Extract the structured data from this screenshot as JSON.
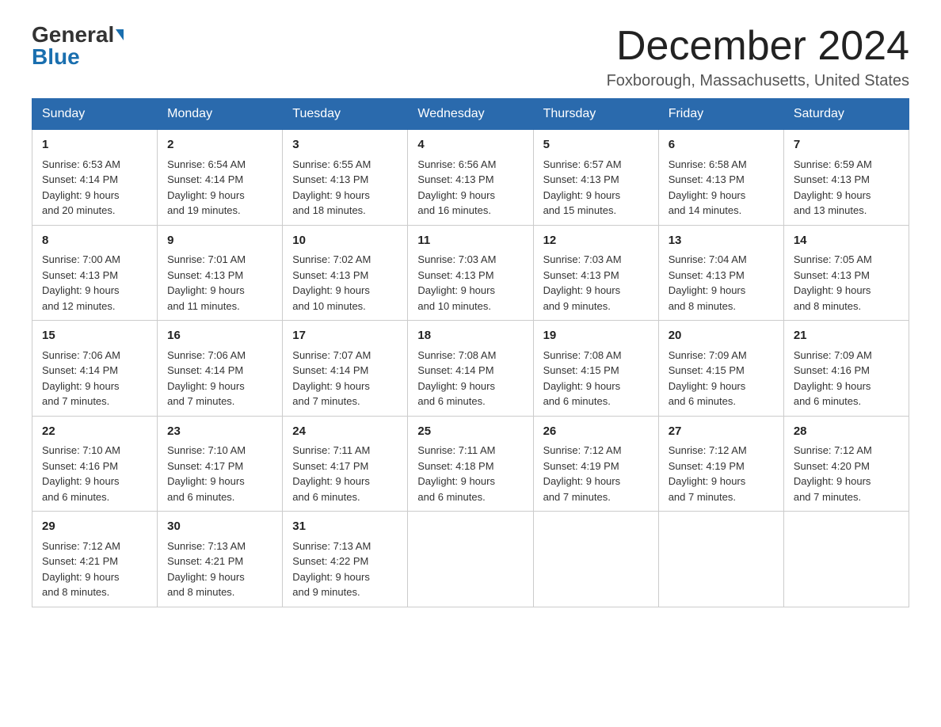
{
  "header": {
    "logo_general": "General",
    "logo_blue": "Blue",
    "month_title": "December 2024",
    "location": "Foxborough, Massachusetts, United States"
  },
  "weekdays": [
    "Sunday",
    "Monday",
    "Tuesday",
    "Wednesday",
    "Thursday",
    "Friday",
    "Saturday"
  ],
  "weeks": [
    [
      {
        "day": "1",
        "sunrise": "6:53 AM",
        "sunset": "4:14 PM",
        "daylight": "9 hours and 20 minutes."
      },
      {
        "day": "2",
        "sunrise": "6:54 AM",
        "sunset": "4:14 PM",
        "daylight": "9 hours and 19 minutes."
      },
      {
        "day": "3",
        "sunrise": "6:55 AM",
        "sunset": "4:13 PM",
        "daylight": "9 hours and 18 minutes."
      },
      {
        "day": "4",
        "sunrise": "6:56 AM",
        "sunset": "4:13 PM",
        "daylight": "9 hours and 16 minutes."
      },
      {
        "day": "5",
        "sunrise": "6:57 AM",
        "sunset": "4:13 PM",
        "daylight": "9 hours and 15 minutes."
      },
      {
        "day": "6",
        "sunrise": "6:58 AM",
        "sunset": "4:13 PM",
        "daylight": "9 hours and 14 minutes."
      },
      {
        "day": "7",
        "sunrise": "6:59 AM",
        "sunset": "4:13 PM",
        "daylight": "9 hours and 13 minutes."
      }
    ],
    [
      {
        "day": "8",
        "sunrise": "7:00 AM",
        "sunset": "4:13 PM",
        "daylight": "9 hours and 12 minutes."
      },
      {
        "day": "9",
        "sunrise": "7:01 AM",
        "sunset": "4:13 PM",
        "daylight": "9 hours and 11 minutes."
      },
      {
        "day": "10",
        "sunrise": "7:02 AM",
        "sunset": "4:13 PM",
        "daylight": "9 hours and 10 minutes."
      },
      {
        "day": "11",
        "sunrise": "7:03 AM",
        "sunset": "4:13 PM",
        "daylight": "9 hours and 10 minutes."
      },
      {
        "day": "12",
        "sunrise": "7:03 AM",
        "sunset": "4:13 PM",
        "daylight": "9 hours and 9 minutes."
      },
      {
        "day": "13",
        "sunrise": "7:04 AM",
        "sunset": "4:13 PM",
        "daylight": "9 hours and 8 minutes."
      },
      {
        "day": "14",
        "sunrise": "7:05 AM",
        "sunset": "4:13 PM",
        "daylight": "9 hours and 8 minutes."
      }
    ],
    [
      {
        "day": "15",
        "sunrise": "7:06 AM",
        "sunset": "4:14 PM",
        "daylight": "9 hours and 7 minutes."
      },
      {
        "day": "16",
        "sunrise": "7:06 AM",
        "sunset": "4:14 PM",
        "daylight": "9 hours and 7 minutes."
      },
      {
        "day": "17",
        "sunrise": "7:07 AM",
        "sunset": "4:14 PM",
        "daylight": "9 hours and 7 minutes."
      },
      {
        "day": "18",
        "sunrise": "7:08 AM",
        "sunset": "4:14 PM",
        "daylight": "9 hours and 6 minutes."
      },
      {
        "day": "19",
        "sunrise": "7:08 AM",
        "sunset": "4:15 PM",
        "daylight": "9 hours and 6 minutes."
      },
      {
        "day": "20",
        "sunrise": "7:09 AM",
        "sunset": "4:15 PM",
        "daylight": "9 hours and 6 minutes."
      },
      {
        "day": "21",
        "sunrise": "7:09 AM",
        "sunset": "4:16 PM",
        "daylight": "9 hours and 6 minutes."
      }
    ],
    [
      {
        "day": "22",
        "sunrise": "7:10 AM",
        "sunset": "4:16 PM",
        "daylight": "9 hours and 6 minutes."
      },
      {
        "day": "23",
        "sunrise": "7:10 AM",
        "sunset": "4:17 PM",
        "daylight": "9 hours and 6 minutes."
      },
      {
        "day": "24",
        "sunrise": "7:11 AM",
        "sunset": "4:17 PM",
        "daylight": "9 hours and 6 minutes."
      },
      {
        "day": "25",
        "sunrise": "7:11 AM",
        "sunset": "4:18 PM",
        "daylight": "9 hours and 6 minutes."
      },
      {
        "day": "26",
        "sunrise": "7:12 AM",
        "sunset": "4:19 PM",
        "daylight": "9 hours and 7 minutes."
      },
      {
        "day": "27",
        "sunrise": "7:12 AM",
        "sunset": "4:19 PM",
        "daylight": "9 hours and 7 minutes."
      },
      {
        "day": "28",
        "sunrise": "7:12 AM",
        "sunset": "4:20 PM",
        "daylight": "9 hours and 7 minutes."
      }
    ],
    [
      {
        "day": "29",
        "sunrise": "7:12 AM",
        "sunset": "4:21 PM",
        "daylight": "9 hours and 8 minutes."
      },
      {
        "day": "30",
        "sunrise": "7:13 AM",
        "sunset": "4:21 PM",
        "daylight": "9 hours and 8 minutes."
      },
      {
        "day": "31",
        "sunrise": "7:13 AM",
        "sunset": "4:22 PM",
        "daylight": "9 hours and 9 minutes."
      },
      null,
      null,
      null,
      null
    ]
  ]
}
